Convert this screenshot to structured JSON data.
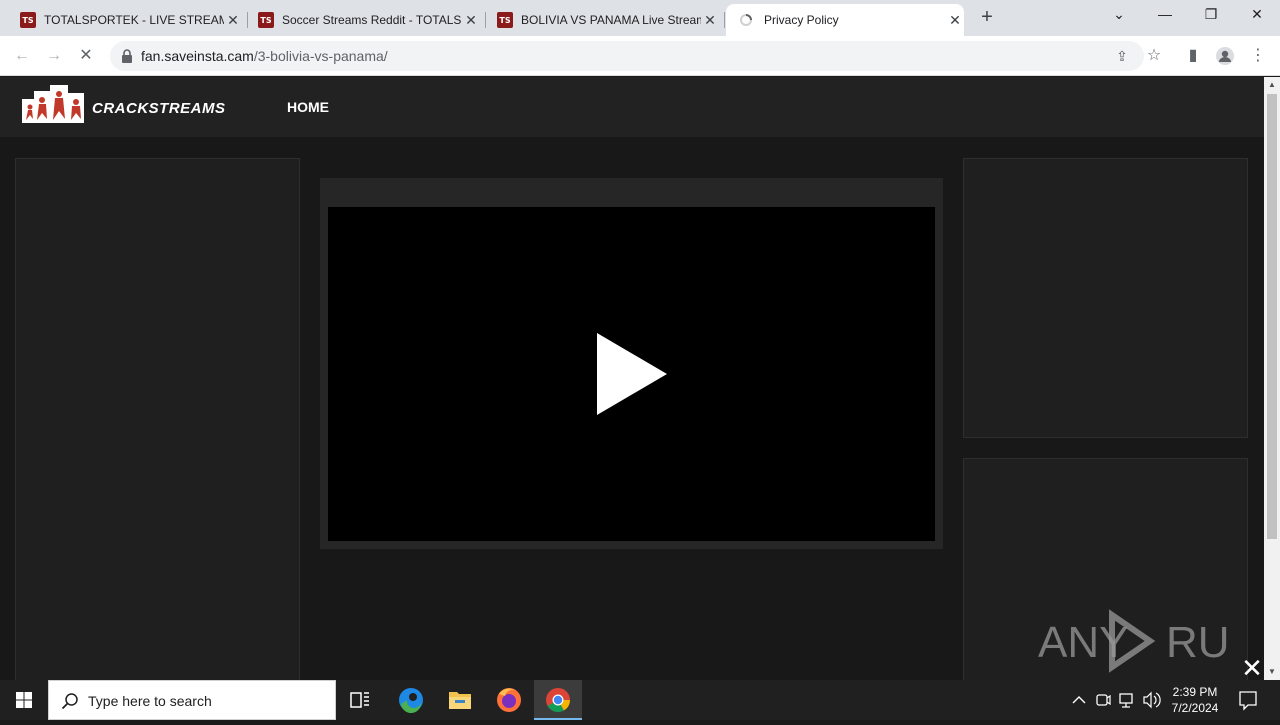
{
  "browser": {
    "tabs": [
      {
        "favicon": "TS",
        "title": "TOTALSPORTEK - LIVE STREAMS",
        "active": false
      },
      {
        "favicon": "TS",
        "title": "Soccer Streams Reddit - TOTALSPORTEK",
        "active": false
      },
      {
        "favicon": "TS",
        "title": "BOLIVIA VS PANAMA Live Stream",
        "active": false
      },
      {
        "favicon": "loading-icon",
        "title": "Privacy Policy",
        "active": true
      }
    ],
    "url_host": "fan.saveinsta.cam",
    "url_path": "/3-bolivia-vs-panama/"
  },
  "site": {
    "brand": "CRACKSTREAMS",
    "nav": {
      "home": "HOME"
    }
  },
  "watermark": "ANY RUN",
  "taskbar": {
    "search_placeholder": "Type here to search",
    "time": "2:39 PM",
    "date": "7/2/2024"
  },
  "colors": {
    "page_bg": "#181818",
    "header_bg": "#222222",
    "panel_bg": "#1f1f1f",
    "player_bg": "#000000",
    "favicon_red": "#8b1a1a"
  }
}
